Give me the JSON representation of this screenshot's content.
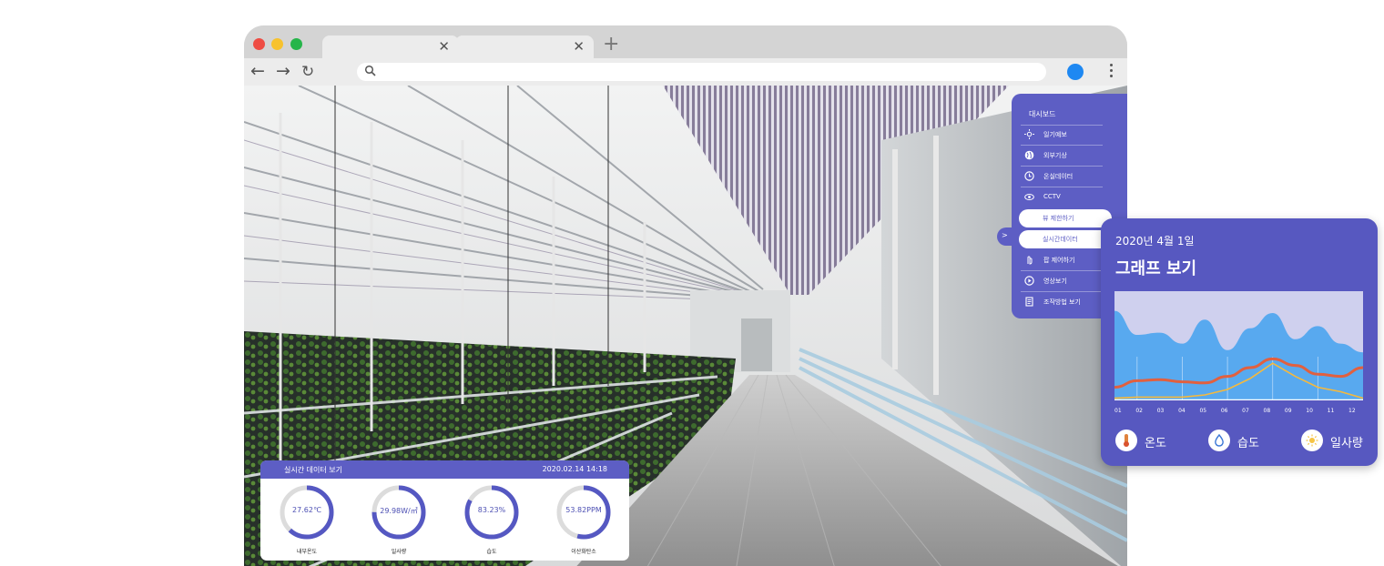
{
  "menu": {
    "title": "대시보드",
    "items": [
      {
        "label": "일기예보",
        "icon": "sun-icon"
      },
      {
        "label": "외부기상",
        "icon": "globe-icon"
      },
      {
        "label": "온실데이터",
        "icon": "clock-icon"
      },
      {
        "label": "CCTV",
        "icon": "eye-icon"
      },
      {
        "label": "뷰 제한하기",
        "icon": ""
      },
      {
        "label": "실시간데이터",
        "icon": ""
      },
      {
        "label": "팝 제어하기",
        "icon": "hand-icon"
      },
      {
        "label": "영상보기",
        "icon": "play-icon"
      },
      {
        "label": "조작방법 보기",
        "icon": "document-icon"
      }
    ],
    "toggle_label": ">"
  },
  "sensor_panel": {
    "title": "실시간 데이터 보기",
    "timestamp": "2020.02.14  14:18",
    "gauges": [
      {
        "value": "27.62℃",
        "label": "내부온도",
        "fraction": 0.62
      },
      {
        "value": "29.98W/㎡",
        "label": "일사량",
        "fraction": 0.75
      },
      {
        "value": "83.23%",
        "label": "습도",
        "fraction": 0.83
      },
      {
        "value": "53.82PPM",
        "label": "이산화탄소",
        "fraction": 0.54
      }
    ]
  },
  "graph_card": {
    "date": "2020년 4월 1일",
    "title": "그래프 보기",
    "legend": [
      {
        "label": "온도",
        "icon": "thermometer-icon"
      },
      {
        "label": "습도",
        "icon": "droplet-icon"
      },
      {
        "label": "일사량",
        "icon": "sun-icon"
      }
    ]
  },
  "chart_data": {
    "type": "area",
    "categories": [
      "01",
      "02",
      "03",
      "04",
      "05",
      "06",
      "07",
      "08",
      "09",
      "10",
      "11",
      "12"
    ],
    "series": [
      {
        "values": [
          82,
          60,
          62,
          52,
          74,
          46,
          66,
          80,
          56,
          68,
          52,
          44
        ]
      },
      {
        "values": [
          12,
          18,
          19,
          17,
          16,
          22,
          30,
          38,
          32,
          24,
          22,
          30
        ]
      },
      {
        "values": [
          2,
          3,
          3,
          3,
          5,
          10,
          20,
          34,
          22,
          12,
          8,
          2
        ]
      }
    ],
    "colors": [
      "#58a9ef",
      "#e1603f",
      "#f6b93c"
    ],
    "ylim": [
      0,
      100
    ]
  }
}
